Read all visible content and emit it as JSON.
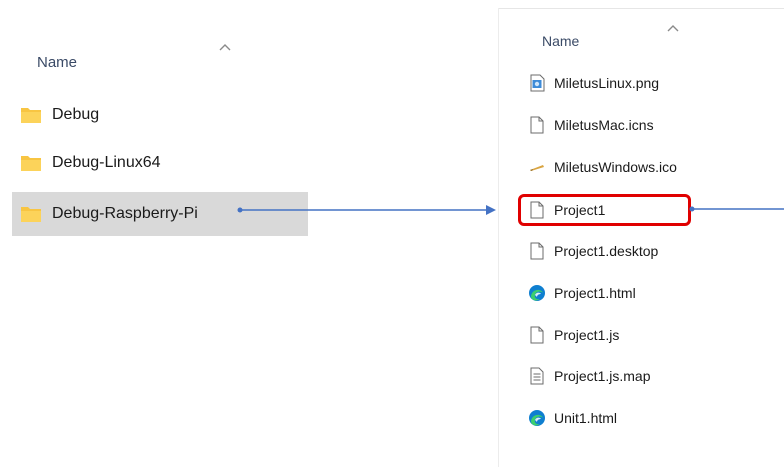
{
  "left_pane": {
    "header": {
      "name_label": "Name"
    },
    "items": [
      {
        "label": "Debug",
        "icon": "folder-icon"
      },
      {
        "label": "Debug-Linux64",
        "icon": "folder-icon"
      },
      {
        "label": "Debug-Raspberry-Pi",
        "icon": "folder-icon",
        "selected": true
      }
    ]
  },
  "right_pane": {
    "header": {
      "name_label": "Name"
    },
    "items": [
      {
        "label": "MiletusLinux.png",
        "icon": "image-file-icon"
      },
      {
        "label": "MiletusMac.icns",
        "icon": "blank-file-icon"
      },
      {
        "label": "MiletusWindows.ico",
        "icon": "ico-file-icon"
      },
      {
        "label": "Project1",
        "icon": "blank-file-icon",
        "highlighted": true
      },
      {
        "label": "Project1.desktop",
        "icon": "blank-file-icon"
      },
      {
        "label": "Project1.html",
        "icon": "edge-browser-icon"
      },
      {
        "label": "Project1.js",
        "icon": "blank-file-icon"
      },
      {
        "label": "Project1.js.map",
        "icon": "text-file-icon"
      },
      {
        "label": "Unit1.html",
        "icon": "edge-browser-icon"
      }
    ]
  },
  "colors": {
    "folder": "#f8c542",
    "selection": "#d9d9d9",
    "arrow": "#4472c4",
    "highlight_border": "#e00000",
    "edge_blue": "#0f7fd0",
    "edge_green": "#3ccf6e"
  }
}
